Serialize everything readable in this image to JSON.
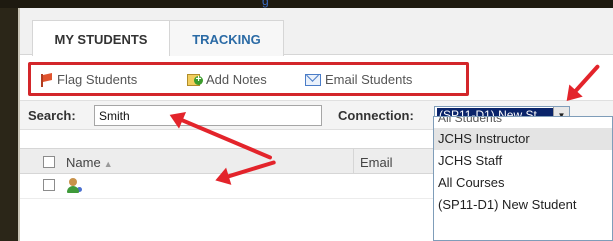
{
  "top_link": "g",
  "tabs": [
    {
      "label": "MY STUDENTS"
    },
    {
      "label": "TRACKING"
    }
  ],
  "toolbar": {
    "flag_label": "Flag Students",
    "notes_label": "Add Notes",
    "email_label": "Email Students"
  },
  "search": {
    "label": "Search:",
    "value": "Smith"
  },
  "connection": {
    "label": "Connection:",
    "selected": "(SP11-D1) New St",
    "options": [
      "All Students",
      "JCHS Instructor",
      "JCHS Staff",
      "All Courses",
      "(SP11-D1) New Student"
    ],
    "highlighted_option": "JCHS Instructor"
  },
  "table": {
    "columns": [
      "Name",
      "Email"
    ]
  },
  "colors": {
    "annotation_red": "#d3262a",
    "tab_link_blue": "#2a6aa5",
    "selection_blue": "#0a246a"
  },
  "icons": [
    "flag-icon",
    "add-note-icon",
    "email-icon",
    "student-icon",
    "sort-ascending-icon",
    "chevron-down-icon"
  ]
}
